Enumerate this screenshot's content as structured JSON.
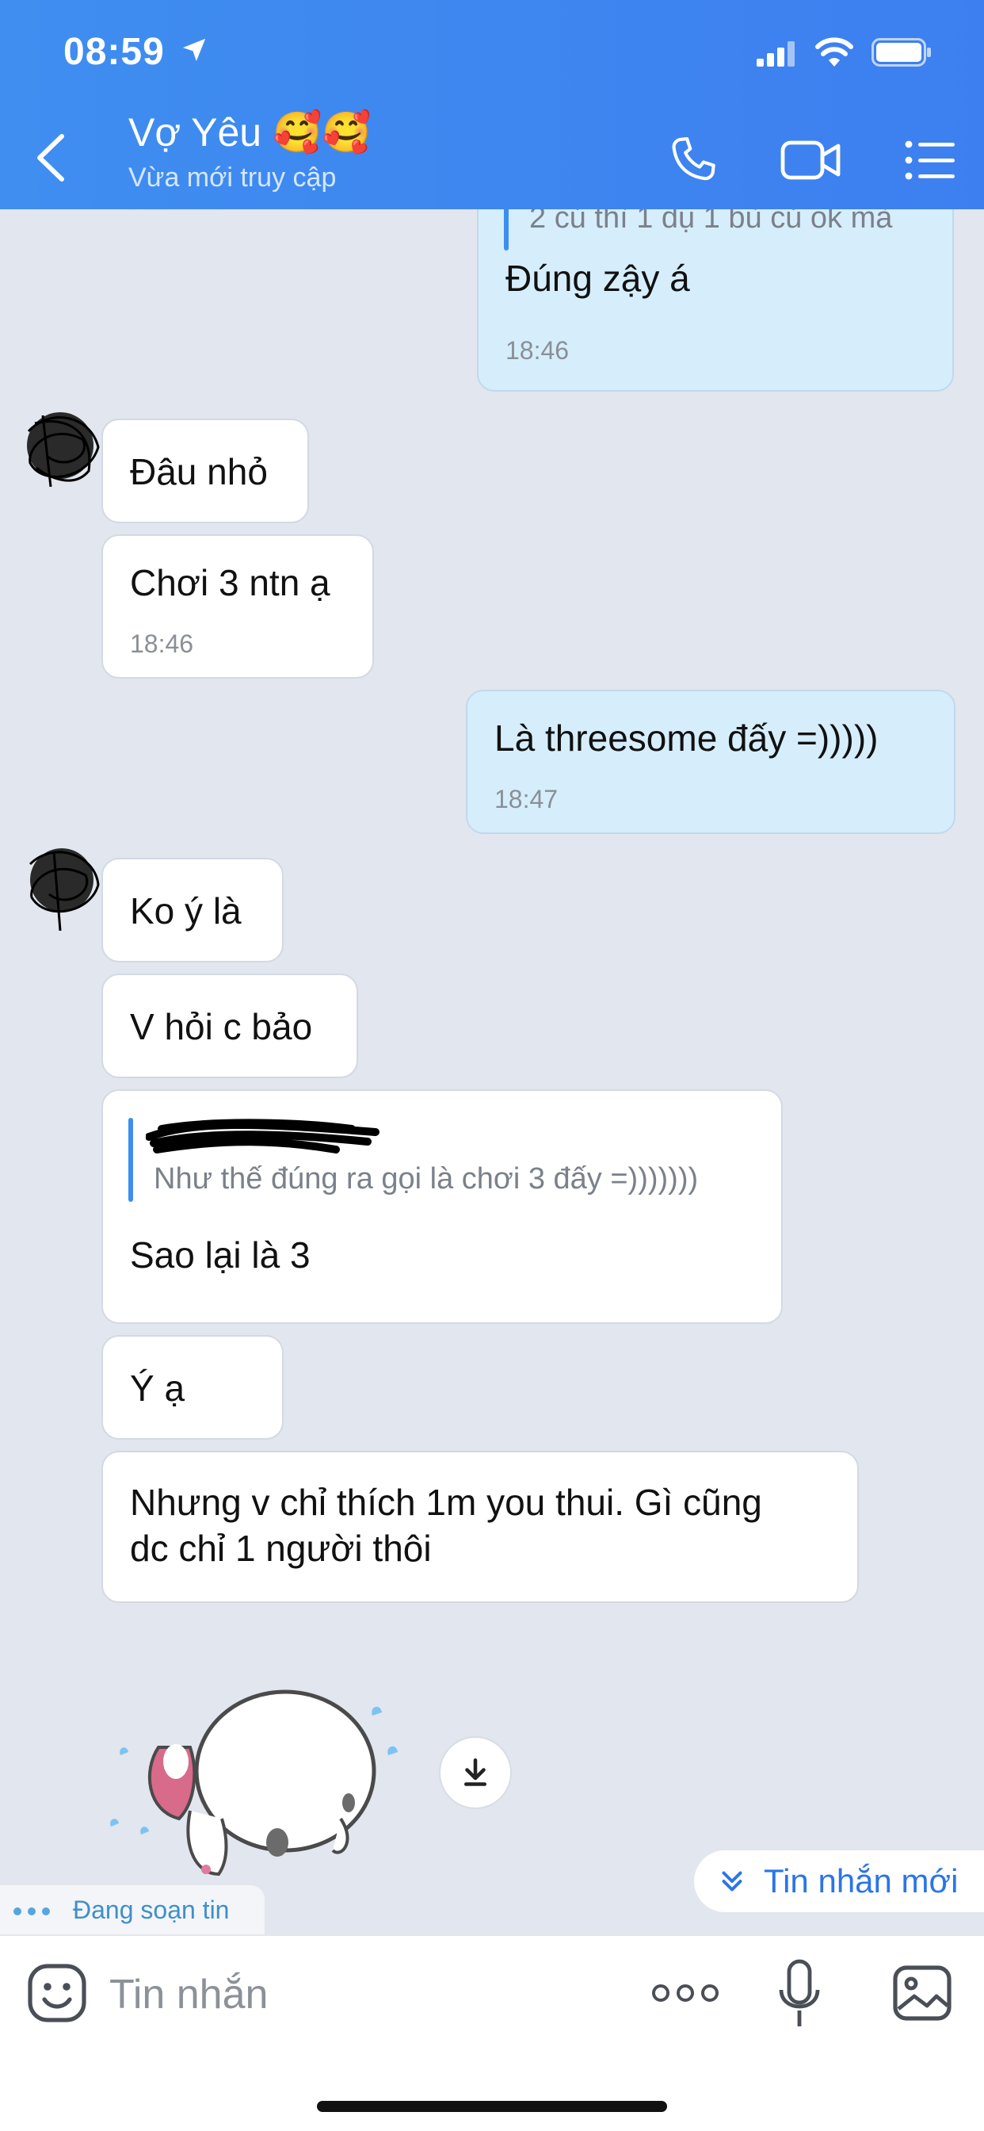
{
  "status_bar": {
    "time": "08:59"
  },
  "header": {
    "contact_name": "Vợ Yêu 🥰🥰",
    "contact_status": "Vừa mới truy cập"
  },
  "messages": [
    {
      "side": "mine",
      "quote": "2 củ thì 1 dụ 1 bù củ ok mà",
      "text": "Đúng zậy á",
      "time": "18:46"
    },
    {
      "side": "theirs",
      "text": "Đâu nhỏ"
    },
    {
      "side": "theirs",
      "text": "Chơi 3 ntn ạ",
      "time": "18:46"
    },
    {
      "side": "mine",
      "text": "Là threesome đấy =)))))",
      "time": "18:47"
    },
    {
      "side": "theirs",
      "text": "Ko ý là"
    },
    {
      "side": "theirs",
      "text": "V hỏi c bảo"
    },
    {
      "side": "theirs",
      "quote": "Như thế đúng ra gọi là chơi 3 đấy =)))))))",
      "text": "Sao lại là 3"
    },
    {
      "side": "theirs",
      "text": "Ý ạ"
    },
    {
      "side": "theirs",
      "text_line1": "Nhưng v chỉ thích 1m you thui. Gì cũng",
      "text_line2": "dc chỉ 1 người thôi"
    }
  ],
  "typing_indicator": "Đang soạn tin",
  "new_messages_button": "Tin nhắn mới",
  "input": {
    "placeholder": "Tin nhắn"
  },
  "icons": {
    "back": "chevron-left-icon",
    "call": "phone-icon",
    "video": "video-camera-icon",
    "menu": "list-icon",
    "emoji": "emoji-icon",
    "more": "ellipsis-icon",
    "mic": "microphone-icon",
    "image": "image-icon",
    "download": "download-icon"
  },
  "colors": {
    "header": "#3f8ef0",
    "accent": "#2b75e6",
    "mine_bubble": "#d6eefc"
  }
}
